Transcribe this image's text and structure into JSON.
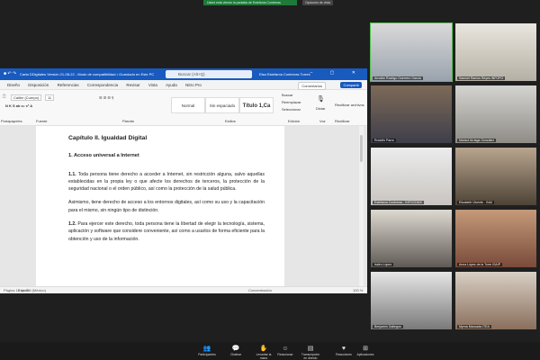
{
  "share_bar": {
    "notice": "Usted está viendo la pantalla de Estefanía Contreras",
    "stop": "Opciones de vista"
  },
  "word": {
    "doc_title": "Carta DDigitales Versión 21-08-22  -  Modo de compatibilidad • Guardado en Este PC",
    "search_placeholder": "Buscar (Alt+Q)",
    "user_name": "Elsa Estefanía Contreras Torres",
    "menu": [
      "Diseño",
      "Disposición",
      "Referencias",
      "Correspondencia",
      "Revisar",
      "Vista",
      "Ayuda",
      "Nitro Pro"
    ],
    "comentarios": "Comentarios",
    "compartir": "Compartir",
    "ribbon": {
      "font": "Calibri (Cuerpo)",
      "font_size": "11",
      "fuente": "Fuente",
      "parrafo": "Párrafo",
      "estilos": "Estilos",
      "edicion": "Edición",
      "voz": "Voz",
      "reutilizar": "Reutilizar",
      "portapapeles": "Portapapeles",
      "normal": "Normal",
      "sin_espaciado": "Sin espaciado",
      "titulo": "Título 1,Ca",
      "buscar": "Buscar",
      "reemplazar": "Reemplazar",
      "seleccionar": "Seleccionar",
      "dictar": "Dictar",
      "reutilizar_archivos": "Reutilizar archivos"
    },
    "document": {
      "h1": "Capítulo II. Igualdad Digital",
      "h2": "1. Acceso universal a Internet",
      "p1_num": "1.1.",
      "p1": " Toda persona tiene derecho a acceder a Internet, sin restricción alguna, salvo aquellas establecidas en la propia ley o que afecte los derechos de terceros, la protección de la seguridad nacional o el orden público, así como la protección de la salud pública.",
      "p2": "Asimismo, tiene derecho de acceso a los entornos digitales, así como su uso y la capacitación para el mismo, sin ningún tipo de distinción.",
      "p3_num": "1.2.",
      "p3": " Para ejercer este derecho, toda persona tiene la libertad de elegir la tecnología, sistema, aplicación y software que considere conveniente, así como a usarlos de forma eficiente para la obtención y uso de la información."
    },
    "status": {
      "page": "Página 10 de 32",
      "lang": "Español (México)",
      "focus": "Concentración",
      "zoom": "100 %"
    }
  },
  "participants": [
    "Arnoldo Rodrigo Guerrero García",
    "Samuel Ramos Reyes INFOPO",
    "Rodolfo Parra",
    "Marisol Arriaga González",
    "Estefanía Contreras - INFOCDMX",
    "Elizabeth Vicente - INAI",
    "Isidro López",
    "Anna López de la Torre ISAIP",
    "Benjamín Gallegos",
    "Myrna Moncada ITEA"
  ],
  "toolbar": [
    "Participantes",
    "Chatear",
    "Levantar la mano",
    "Reaccionar",
    "Transcripción en directo",
    "Reacciones",
    "Aplicaciones"
  ],
  "colors": {
    "word_blue": "#185abd",
    "speaking": "#53c24f"
  }
}
